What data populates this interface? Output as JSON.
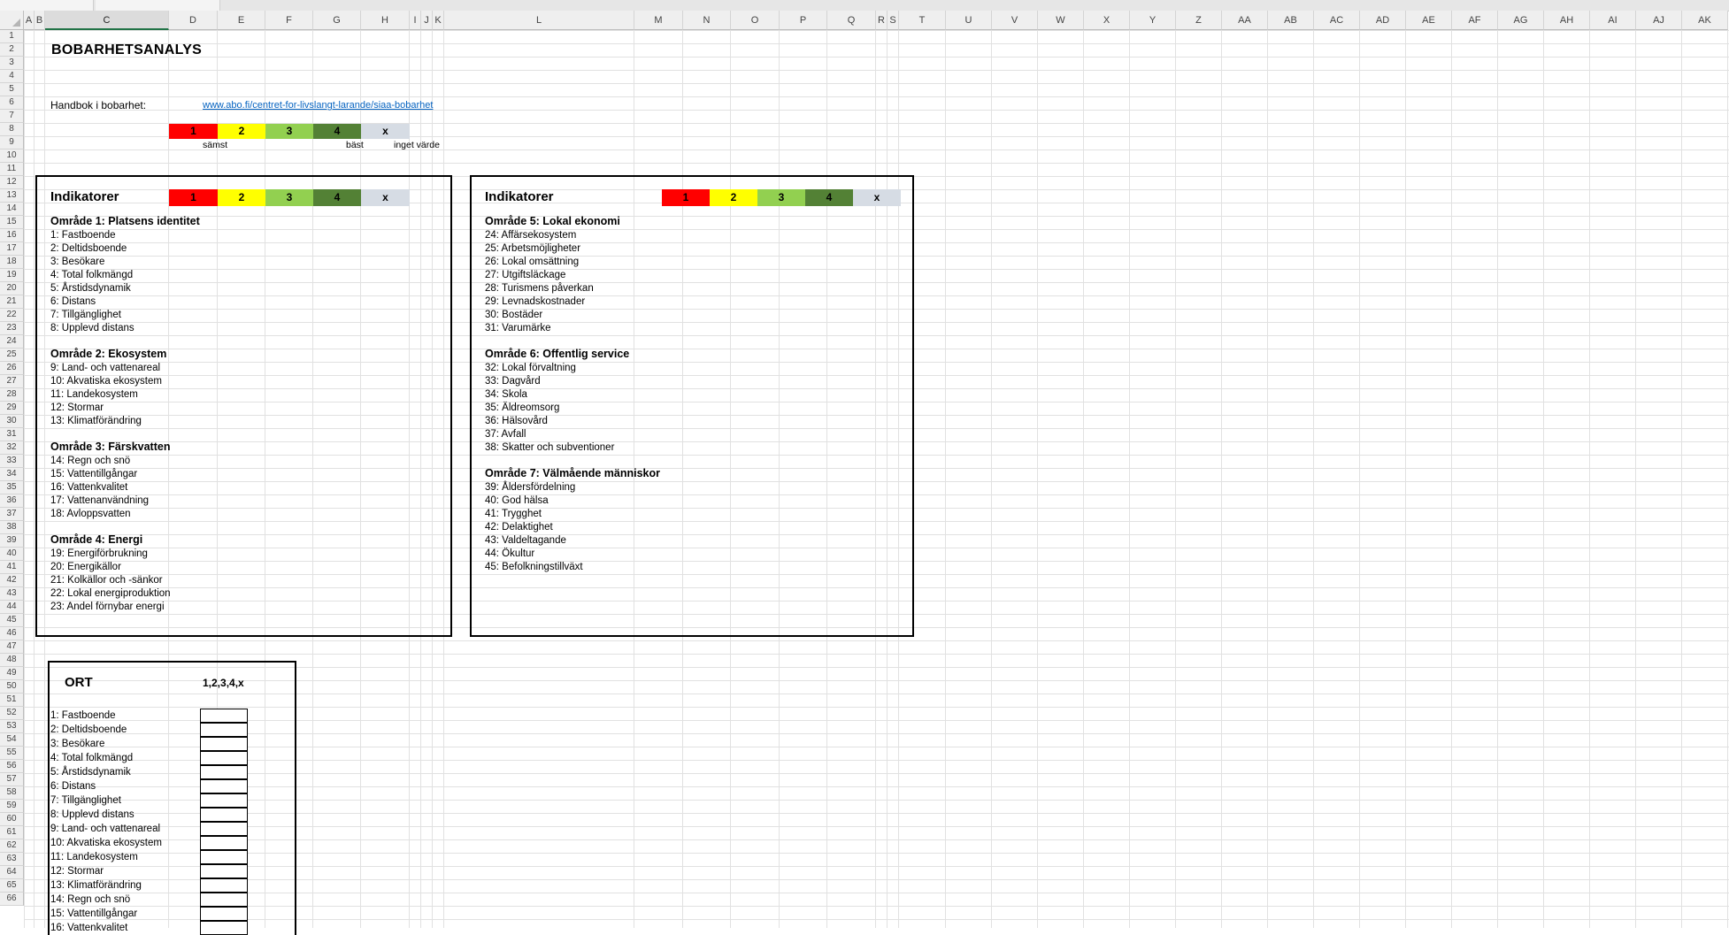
{
  "columns": [
    "A",
    "B",
    "C",
    "D",
    "E",
    "F",
    "G",
    "H",
    "I",
    "J",
    "K",
    "L",
    "M",
    "N",
    "O",
    "P",
    "Q",
    "R",
    "S",
    "T",
    "U",
    "V",
    "W",
    "X",
    "Y",
    "Z",
    "AA",
    "AB",
    "AC",
    "AD",
    "AE",
    "AF",
    "AG",
    "AH",
    "AI",
    "AJ",
    "AK"
  ],
  "rows": [
    "1",
    "2",
    "3",
    "4",
    "5",
    "6",
    "7",
    "8",
    "9",
    "10",
    "11",
    "12",
    "13",
    "14",
    "15",
    "16",
    "17",
    "18",
    "19",
    "20",
    "21",
    "22",
    "23",
    "24",
    "25",
    "26",
    "27",
    "28",
    "29",
    "30",
    "31",
    "32",
    "33",
    "34",
    "35",
    "36",
    "37",
    "38",
    "39",
    "40",
    "41",
    "42",
    "43",
    "44",
    "45",
    "46",
    "47",
    "48",
    "49",
    "50",
    "51",
    "52",
    "53",
    "54",
    "55",
    "56",
    "57",
    "58",
    "59",
    "60",
    "61",
    "62",
    "63",
    "64",
    "65",
    "66"
  ],
  "selected_column": "C",
  "title": "BOBARHETSANALYS",
  "handbook": {
    "label": "Handbok i bobarhet:",
    "url_text": "www.abo.fi/centret-for-livslangt-larande/siaa-bobarhet"
  },
  "scale": {
    "items": [
      {
        "label": "1",
        "color": "#ff0000"
      },
      {
        "label": "2",
        "color": "#ffff00"
      },
      {
        "label": "3",
        "color": "#92d050"
      },
      {
        "label": "4",
        "color": "#538135"
      },
      {
        "label": "x",
        "color": "#d6dce4"
      }
    ],
    "worst": "sämst",
    "best": "bäst",
    "no_value": "inget värde"
  },
  "left_panel": {
    "heading": "Indikatorer",
    "areas": [
      {
        "title": "Område 1: Platsens identitet",
        "items": [
          "1: Fastboende",
          "2: Deltidsboende",
          "3: Besökare",
          "4: Total folkmängd",
          "5: Årstidsdynamik",
          "6: Distans",
          "7: Tillgänglighet",
          "8: Upplevd distans"
        ]
      },
      {
        "title": "Område 2: Ekosystem",
        "items": [
          "9: Land- och vattenareal",
          "10: Akvatiska ekosystem",
          "11: Landekosystem",
          "12: Stormar",
          "13: Klimatförändring"
        ]
      },
      {
        "title": "Område 3: Färskvatten",
        "items": [
          "14: Regn och snö",
          "15: Vattentillgångar",
          "16: Vattenkvalitet",
          "17: Vattenanvändning",
          "18: Avloppsvatten"
        ]
      },
      {
        "title": "Område 4: Energi",
        "items": [
          "19: Energiförbrukning",
          "20: Energikällor",
          "21: Kolkällor och -sänkor",
          "22: Lokal energiproduktion",
          "23: Andel förnybar energi"
        ]
      }
    ]
  },
  "right_panel": {
    "heading": "Indikatorer",
    "areas": [
      {
        "title": "Område 5: Lokal ekonomi",
        "items": [
          "24: Affärsekosystem",
          "25: Arbetsmöjligheter",
          "26: Lokal omsättning",
          "27: Utgiftsläckage",
          "28: Turismens påverkan",
          "29: Levnadskostnader",
          "30: Bostäder",
          "31: Varumärke"
        ]
      },
      {
        "title": "Område 6: Offentlig service",
        "items": [
          "32: Lokal förvaltning",
          "33: Dagvård",
          "34: Skola",
          "35: Äldreomsorg",
          "36: Hälsovård",
          "37: Avfall",
          "38: Skatter och subventioner"
        ]
      },
      {
        "title": "Område 7: Välmående människor",
        "items": [
          "39: Åldersfördelning",
          "40: God hälsa",
          "41: Trygghet",
          "42: Delaktighet",
          "43: Valdeltagande",
          "44: Ökultur",
          "45: Befolkningstillväxt"
        ]
      }
    ]
  },
  "ort_panel": {
    "heading": "ORT",
    "scale_header": "1,2,3,4,x",
    "items": [
      "1: Fastboende",
      "2: Deltidsboende",
      "3: Besökare",
      "4: Total folkmängd",
      "5: Årstidsdynamik",
      "6: Distans",
      "7: Tillgänglighet",
      "8: Upplevd distans",
      "9: Land- och vattenareal",
      "10: Akvatiska ekosystem",
      "11: Landekosystem",
      "12: Stormar",
      "13: Klimatförändring",
      "14: Regn och snö",
      "15: Vattentillgångar",
      "16: Vattenkvalitet"
    ]
  }
}
